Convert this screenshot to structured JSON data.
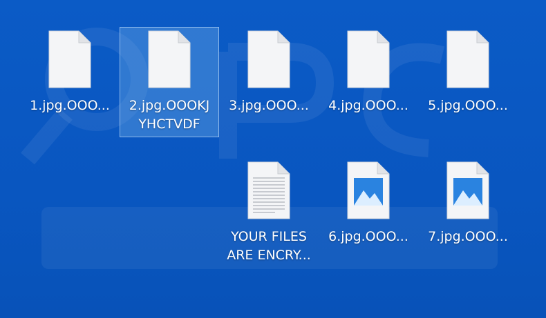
{
  "desktop": {
    "background_color": "#0a59c4",
    "selection_color": "#78b4eb",
    "files": [
      {
        "label": "1.jpg.OOO...",
        "icon": "blank-document-icon",
        "selected": false
      },
      {
        "label": "2.jpg.OOOKJ\nYHCTVDF",
        "icon": "blank-document-icon",
        "selected": true
      },
      {
        "label": "3.jpg.OOO...",
        "icon": "blank-document-icon",
        "selected": false
      },
      {
        "label": "4.jpg.OOO...",
        "icon": "blank-document-icon",
        "selected": false
      },
      {
        "label": "5.jpg.OOO...",
        "icon": "blank-document-icon",
        "selected": false
      },
      {
        "label": "YOUR FILES\nARE ENCRY...",
        "icon": "text-document-icon",
        "selected": false
      },
      {
        "label": "6.jpg.OOO...",
        "icon": "image-file-icon",
        "selected": false
      },
      {
        "label": "7.jpg.OOO...",
        "icon": "image-file-icon",
        "selected": false
      }
    ]
  }
}
